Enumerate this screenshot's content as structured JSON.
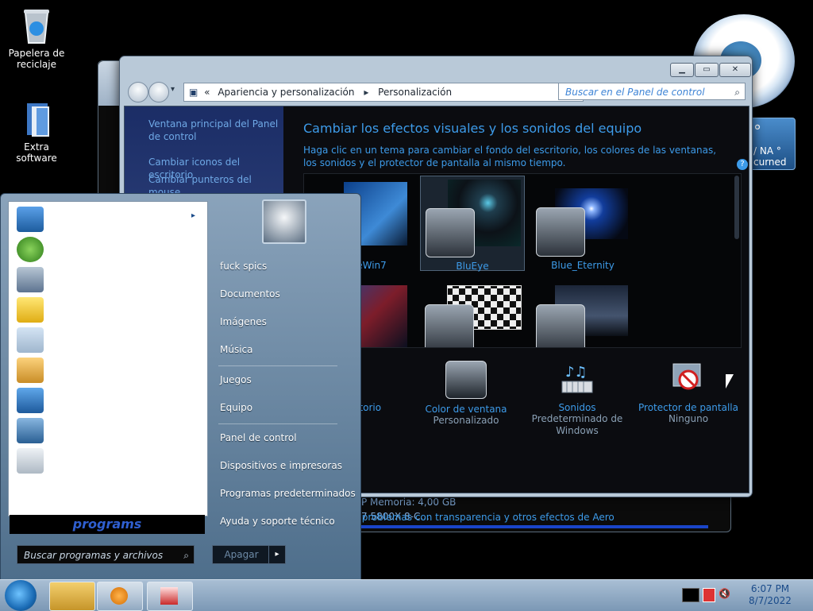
{
  "desktop": {
    "icons": [
      {
        "label": "Papelera de reciclaje"
      },
      {
        "label": "Extra software"
      }
    ]
  },
  "gadgets": {
    "weather_temp": "°",
    "weather_na": "/ NA °",
    "weather_label": "curned"
  },
  "back_window": {
    "system_line1": "P         Memoria: 4,00 GB",
    "system_line2": "7 5800X 8-C..."
  },
  "window": {
    "breadcrumb": [
      "Apariencia y personalización",
      "Personalización"
    ],
    "search_placeholder": "Buscar en el Panel de control",
    "left_links": [
      "Ventana principal del Panel de control",
      "Cambiar iconos del escritorio",
      "Cambiar punteros del mouse"
    ],
    "title": "Cambiar los efectos visuales y los sonidos del equipo",
    "description": "Haga clic en un tema para cambiar el fondo del escritorio, los colores de las ventanas, los sonidos y el protector de pantalla al mismo tiempo.",
    "themes": [
      {
        "name": "eWin7"
      },
      {
        "name": "BluEye"
      },
      {
        "name": "Blue_Eternity"
      }
    ],
    "bottom_items": [
      {
        "label": "escritorio",
        "sub": ""
      },
      {
        "label": "Color de ventana",
        "sub": "Personalizado"
      },
      {
        "label": "Sonidos",
        "sub": "Predeterminado de Windows"
      },
      {
        "label": "Protector de pantalla",
        "sub": "Ninguno"
      }
    ],
    "aero_link": "r problemas con transparencia y otros efectos de Aero"
  },
  "start_menu": {
    "programs_label": "programs",
    "search_placeholder": "Buscar programas y archivos",
    "right_items": [
      "fuck spics",
      "Documentos",
      "Imágenes",
      "Música",
      "Juegos",
      "Equipo",
      "Panel de control",
      "Dispositivos e impresoras",
      "Programas predeterminados",
      "Ayuda y soporte técnico"
    ],
    "power_label": "Apagar"
  },
  "taskbar": {
    "time": "6:07 PM",
    "date": "8/7/2022"
  },
  "colors": {
    "accent": "#3d9be9",
    "taskbar": "#8ca8c3"
  }
}
